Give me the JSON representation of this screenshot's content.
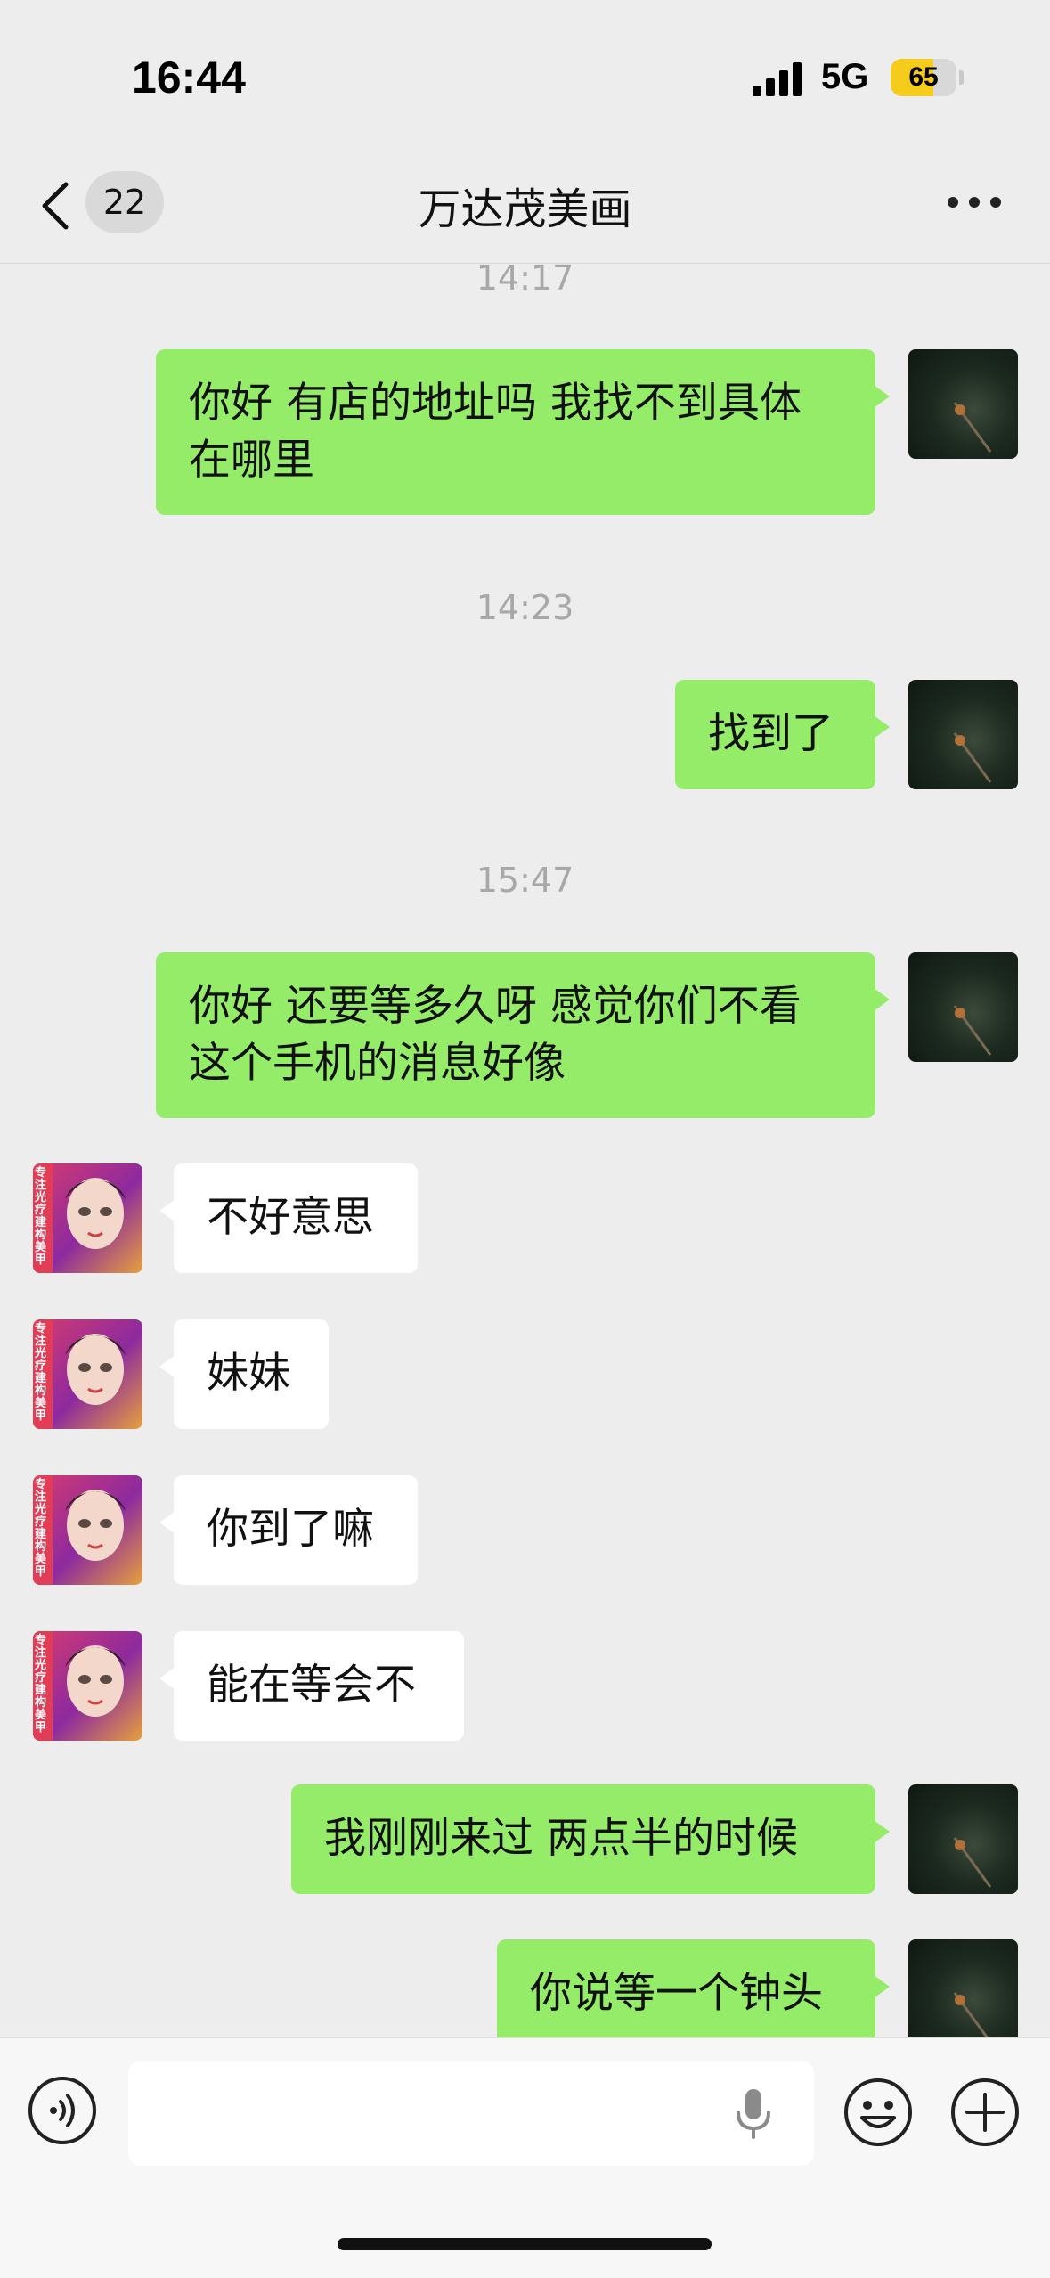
{
  "status_bar": {
    "time": "16:44",
    "network": "5G",
    "battery": "65",
    "battery_level": 0.65
  },
  "nav": {
    "back_count": "22",
    "title": "万达茂美画"
  },
  "messages": [
    {
      "type": "timestamp",
      "text": "14:17"
    },
    {
      "type": "me",
      "text": "你好 有店的地址吗 我找不到具体在哪里"
    },
    {
      "type": "timestamp",
      "text": "14:23"
    },
    {
      "type": "me",
      "text": "找到了"
    },
    {
      "type": "timestamp",
      "text": "15:47"
    },
    {
      "type": "me",
      "text": "你好 还要等多久呀 感觉你们不看这个手机的消息好像"
    },
    {
      "type": "them",
      "text": "不好意思"
    },
    {
      "type": "them",
      "text": "妹妹"
    },
    {
      "type": "them",
      "text": "你到了嘛"
    },
    {
      "type": "them",
      "text": "能在等会不"
    },
    {
      "type": "me",
      "text": "我刚刚来过 两点半的时候"
    },
    {
      "type": "me",
      "text": "你说等一个钟头"
    }
  ],
  "them_avatar_text": "专注光疗建构美甲",
  "colors": {
    "me_bubble": "#95ec69",
    "them_bubble": "#ffffff",
    "background": "#ededed",
    "battery": "#f5cb1c"
  },
  "icons": {
    "back": "chevron-left-icon",
    "more": "more-dots-icon",
    "voice": "voice-icon",
    "mic": "mic-icon",
    "emoji": "emoji-icon",
    "plus": "plus-icon"
  }
}
